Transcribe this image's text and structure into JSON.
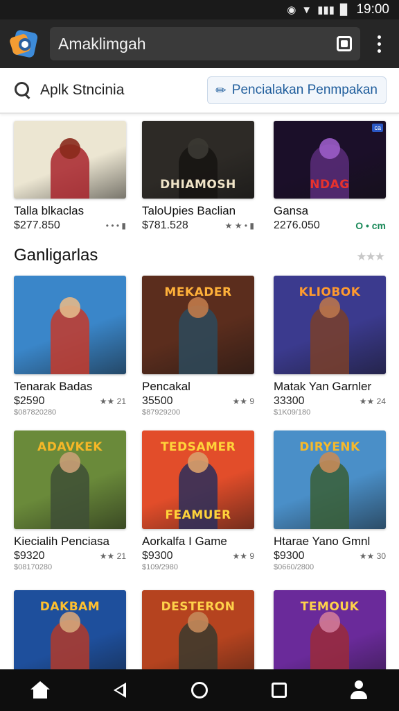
{
  "status_bar": {
    "time": "19:00",
    "icons": [
      "eye-icon",
      "wifi-icon",
      "signal-icon",
      "battery-icon"
    ]
  },
  "app_bar": {
    "logo": "app-logo-icon",
    "search_value": "Amaklimgah",
    "icons": [
      "scan-icon",
      "more-vert-icon"
    ]
  },
  "search": {
    "label": "Aplk Stncinia",
    "button_label": "Pencialakan Penmpakan",
    "button_icon": "pin-icon"
  },
  "top_row": [
    {
      "title": "Talla blkaclas",
      "price": "$277.850",
      "meta": "• • • ▮",
      "banner": "",
      "palette": {
        "bg": "#ece6d2",
        "fig": "#a8232b",
        "head": "#8a2a1c",
        "banner": "#222"
      }
    },
    {
      "title": "TaloUpies Baclian",
      "price": "$781.528",
      "meta": "★ ★ • ▮",
      "banner": "DHIAMOSH",
      "palette": {
        "bg": "#2d2a26",
        "fig": "#161412",
        "head": "#3b3833",
        "banner": "#f0e4c8"
      }
    },
    {
      "title": "Gansa",
      "price": "2276.050",
      "meta": "O • cm",
      "banner": "NDAG",
      "badge": "ca",
      "palette": {
        "bg": "#1b0f29",
        "fig": "#5a2d7a",
        "head": "#9a5cc6",
        "banner": "#e8322d"
      }
    }
  ],
  "section": {
    "title": "Ganligarlas",
    "stars": "★★★"
  },
  "grid": [
    {
      "title": "Tenarak Badas",
      "price": "$2590",
      "sub": "$087820280",
      "meta": "★★ 21",
      "banner": "",
      "palette": {
        "bg": "#3a86c9",
        "fig": "#c53a2a",
        "head": "#e3b88a",
        "banner": "#ffd13a"
      }
    },
    {
      "title": "Pencakal",
      "price": "35500",
      "sub": "$87929200",
      "meta": "★★ 9",
      "banner": "MEKADER",
      "palette": {
        "bg": "#5b2d1d",
        "fig": "#2d4a5c",
        "head": "#c07a4a",
        "banner": "#ffb13a"
      }
    },
    {
      "title": "Matak Yan Garnler",
      "price": "33300",
      "sub": "$1K09/180",
      "meta": "★★ 24",
      "banner": "KLIOBOK",
      "palette": {
        "bg": "#3b3a8e",
        "fig": "#7a3f2a",
        "head": "#b9744c",
        "banner": "#ff9a2e"
      }
    },
    {
      "title": "Kiecialih Penciasa",
      "price": "$9320",
      "sub": "$08170280",
      "meta": "★★ 21",
      "banner": "ADAVKEK",
      "palette": {
        "bg": "#6a8a3a",
        "fig": "#3e4f36",
        "head": "#c9a077",
        "banner": "#f5b727"
      }
    },
    {
      "title": "Aorkalfa I Game",
      "price": "$9300",
      "sub": "$109/2980",
      "meta": "★★ 9",
      "banner": "TEDSAMER",
      "palette": {
        "bg": "#e24d2a",
        "fig": "#2a2f5c",
        "head": "#d9a06b",
        "banner": "#ffd43a"
      },
      "banner2": "FEAMUER"
    },
    {
      "title": "Htarae Yano Gmnl",
      "price": "$9300",
      "sub": "$0660/2800",
      "meta": "★★ 30",
      "banner": "DIRYENK",
      "palette": {
        "bg": "#4a8fc8",
        "fig": "#3a5f36",
        "head": "#c58b59",
        "banner": "#f5b92b"
      }
    },
    {
      "title": "",
      "price": "",
      "sub": "",
      "meta": "",
      "banner": "DAKBAM",
      "palette": {
        "bg": "#1e4f9c",
        "fig": "#b23a2a",
        "head": "#d6a57a",
        "banner": "#ffc02e"
      }
    },
    {
      "title": "",
      "price": "",
      "sub": "",
      "meta": "",
      "banner": "DESTERON",
      "palette": {
        "bg": "#b5431f",
        "fig": "#3a3a2e",
        "head": "#c48a5a",
        "banner": "#ffd24a"
      }
    },
    {
      "title": "",
      "price": "",
      "sub": "",
      "meta": "",
      "banner": "TEMOUK",
      "palette": {
        "bg": "#6a2a9a",
        "fig": "#9a2a3a",
        "head": "#d07a9a",
        "banner": "#ffd24a"
      }
    }
  ],
  "nav_bar": {
    "icons": [
      "home-icon",
      "back-icon",
      "home-circle-icon",
      "recents-icon",
      "profile-icon"
    ]
  }
}
